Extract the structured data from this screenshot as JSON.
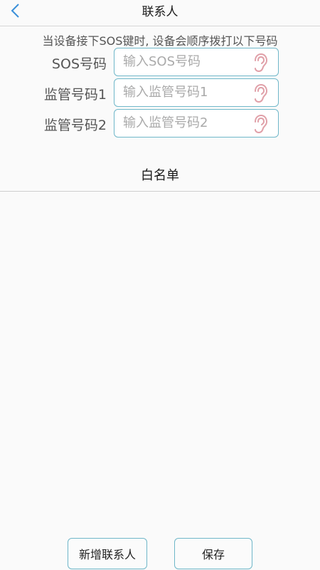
{
  "header": {
    "title": "联系人"
  },
  "description": "当设备接下SOS键时, 设备会顺序拨打以下号码",
  "fields": [
    {
      "label": "SOS号码",
      "placeholder": "输入SOS号码",
      "value": "",
      "icon": "ear-icon"
    },
    {
      "label": "监管号码1",
      "placeholder": "输入监管号码1",
      "value": "",
      "icon": "ear-icon"
    },
    {
      "label": "监管号码2",
      "placeholder": "输入监管号码2",
      "value": "",
      "icon": "ear-icon"
    }
  ],
  "whitelist": {
    "title": "白名单",
    "items": []
  },
  "buttons": {
    "add_contact": "新增联系人",
    "save": "保存"
  },
  "colors": {
    "accent": "#6fb7c9",
    "back_icon": "#3a8fd9",
    "ear_icon": "#e0a0a8"
  }
}
